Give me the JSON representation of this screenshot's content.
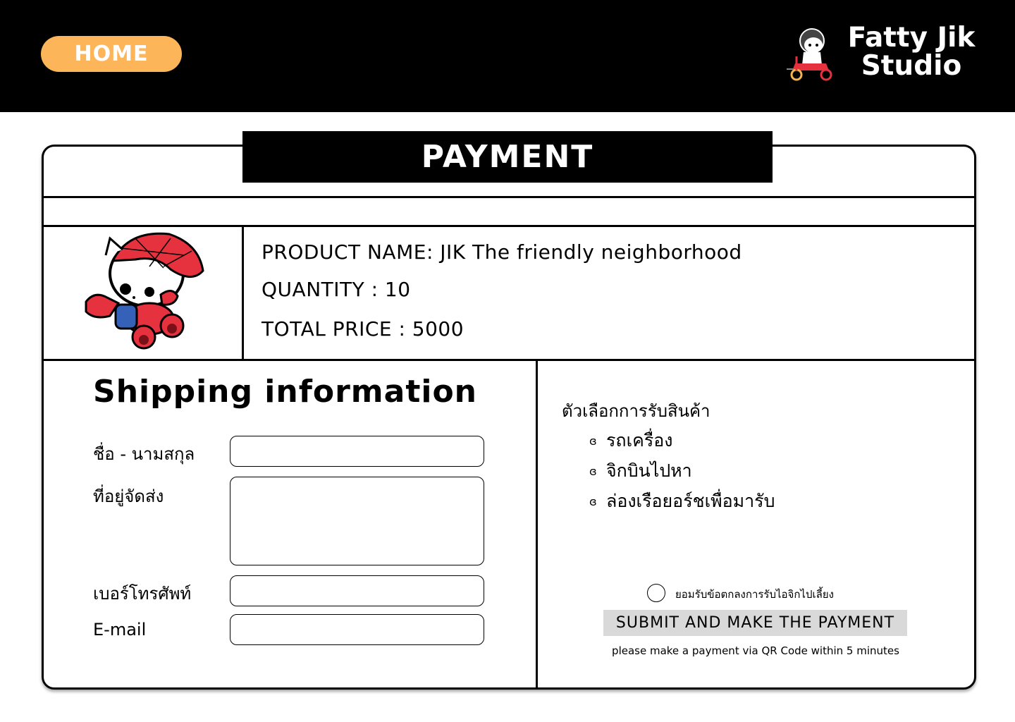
{
  "header": {
    "home_label": "HOME",
    "logo_line1": "Fatty Jik",
    "logo_line2": "Studio"
  },
  "payment": {
    "title": "PAYMENT"
  },
  "product": {
    "name_line": "PRODUCT NAME: JIK The friendly neighborhood",
    "quantity_line": "QUANTITY : 10",
    "total_line": "TOTAL PRICE : 5000",
    "image_icon": "spider-costume-cat-mascot"
  },
  "shipping": {
    "title": "Shipping information",
    "fields": [
      {
        "label": "ชื่อ - นามสกุล",
        "value": ""
      },
      {
        "label": "ที่อยู่จัดส่ง",
        "value": ""
      },
      {
        "label": "เบอร์โทรศัพท์",
        "value": ""
      },
      {
        "label": "E-mail",
        "value": ""
      }
    ]
  },
  "delivery": {
    "title": "ตัวเลือกการรับสินค้า",
    "bullet_icon": "bullet-glyph",
    "options": [
      {
        "label": "รถเครื่อง"
      },
      {
        "label": "จิกบินไปหา"
      },
      {
        "label": "ล่องเรือยอร์ชเพื่อมารับ"
      }
    ]
  },
  "agreement": {
    "label": "ยอมรับข้อตกลงการรับไอจิกไปเลี้ยง",
    "checked": false
  },
  "submit": {
    "label": "SUBMIT AND MAKE THE PAYMENT",
    "note": "please make a payment via QR Code within 5 minutes"
  },
  "colors": {
    "header_bg": "#000000",
    "home_button": "#fdb55a",
    "submit_bg": "#d9d9d9",
    "mascot_red": "#e6323e"
  }
}
